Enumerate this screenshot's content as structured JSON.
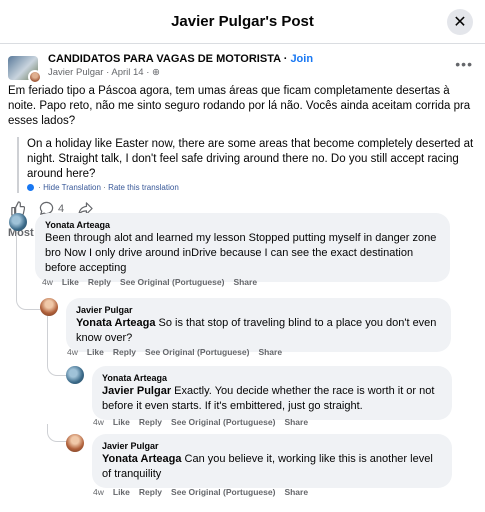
{
  "header": {
    "title": "Javier Pulgar's Post",
    "close_icon": "close-icon"
  },
  "post": {
    "group_name": "CANDIDATOS PARA VAGAS DE MOTORISTA",
    "join_label": "Join",
    "author": "Javier Pulgar",
    "date": "April 14",
    "text": "Em feriado tipo a Páscoa agora, tem umas áreas que ficam completamente desertas à noite. Papo reto, não me sinto seguro rodando por lá não. Vocês ainda aceitam corrida pra esses lados?",
    "translation": "On a holiday like Easter now, there are some areas that become completely deserted at night. Straight talk, I don't feel safe driving around there no. Do you still accept racing around here?",
    "hide_translation": "Hide Translation",
    "rate_translation": "Rate this translation",
    "comment_count": "4"
  },
  "sort_label": "Most relevant",
  "comments": [
    {
      "author": "Yonata Arteaga",
      "tag": "",
      "text": "Been through alot and learned my lesson Stopped putting myself in danger zone bro Now I only drive around inDrive because I can see the exact destination before accepting",
      "time": "4w",
      "like": "Like",
      "reply": "Reply",
      "see_original": "See Original (Portuguese)",
      "share": "Share"
    },
    {
      "author": "Javier Pulgar",
      "tag": "Yonata Arteaga",
      "text": "So is that stop of traveling blind to a place you don't even know over?",
      "time": "4w",
      "like": "Like",
      "reply": "Reply",
      "see_original": "See Original (Portuguese)",
      "share": "Share"
    },
    {
      "author": "Yonata Arteaga",
      "tag": "Javier Pulgar",
      "text": "Exactly. You decide whether the race is worth it or not before it even starts. If it's embittered, just go straight.",
      "time": "4w",
      "like": "Like",
      "reply": "Reply",
      "see_original": "See Original (Portuguese)",
      "share": "Share"
    },
    {
      "author": "Javier Pulgar",
      "tag": "Yonata Arteaga",
      "text": "Can you believe it, working like this is another level of tranquility",
      "time": "4w",
      "like": "Like",
      "reply": "Reply",
      "see_original": "See Original (Portuguese)",
      "share": "Share"
    }
  ]
}
